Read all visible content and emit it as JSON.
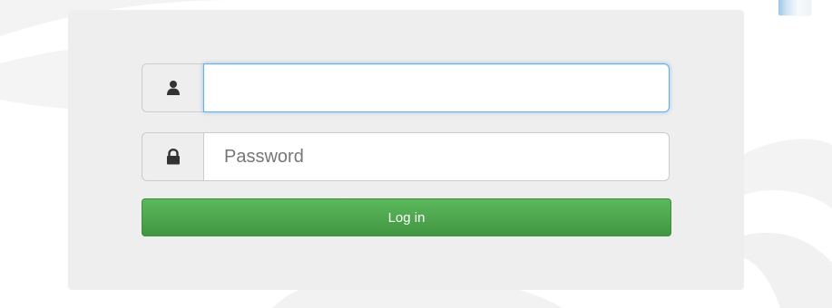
{
  "login_form": {
    "username": {
      "icon": "user-icon",
      "value": "",
      "placeholder": ""
    },
    "password": {
      "icon": "lock-icon",
      "value": "",
      "placeholder": "Password"
    },
    "submit_label": "Log in"
  },
  "colors": {
    "panel_background": "#eeeeee",
    "button_green": "#5cb85c",
    "focus_blue": "#66afe9"
  }
}
